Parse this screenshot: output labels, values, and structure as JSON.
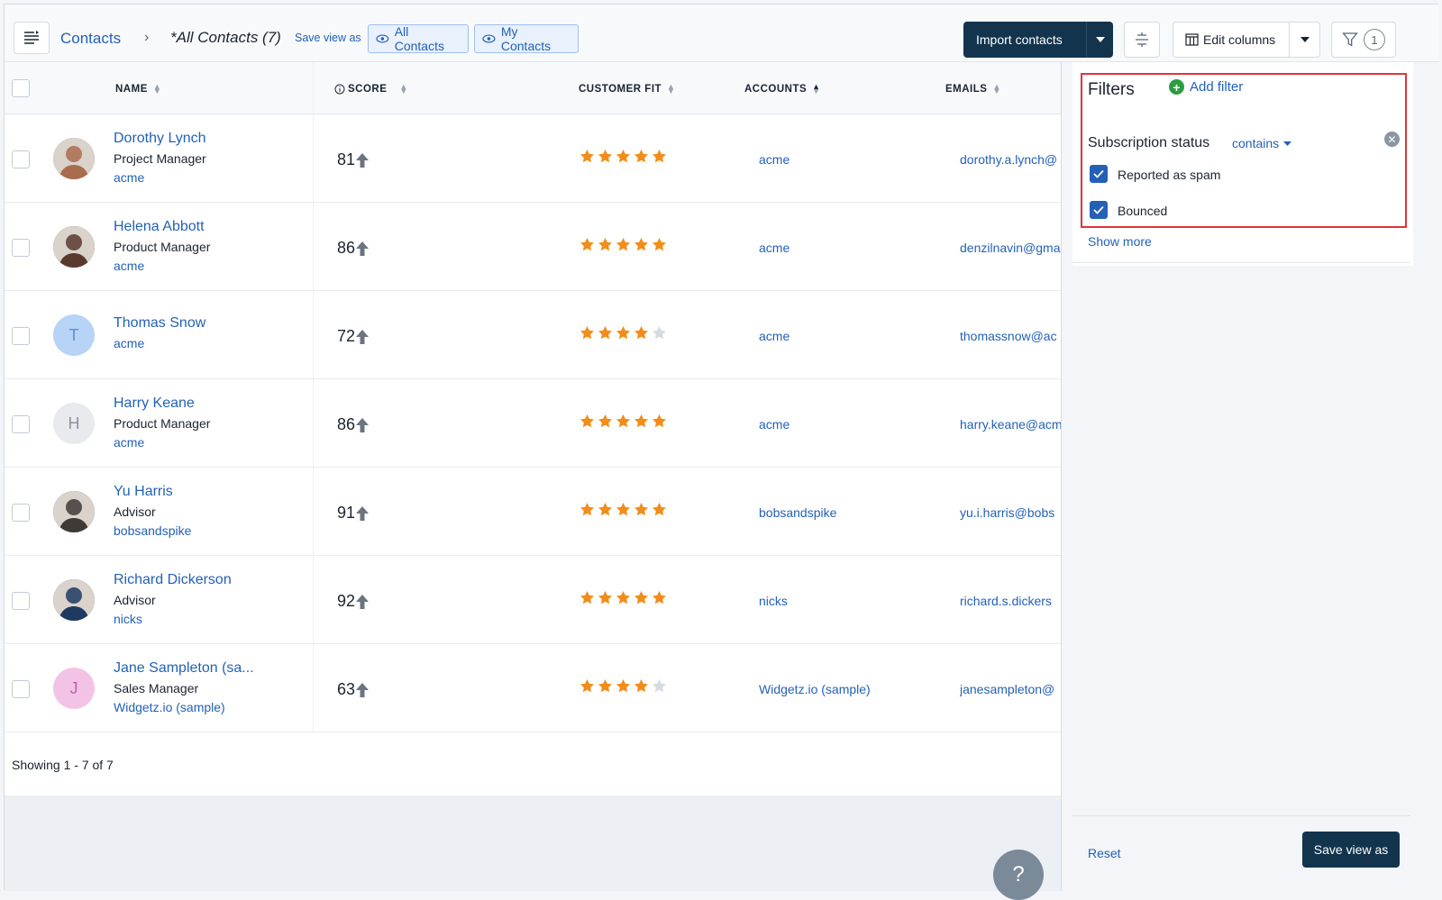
{
  "header": {
    "breadcrumb_root": "Contacts",
    "view_title": "*All Contacts (7)",
    "save_view_as": "Save view as",
    "view_pills": [
      "All Contacts",
      "My Contacts"
    ],
    "import_button": "Import contacts",
    "edit_columns": "Edit columns",
    "filter_count": "1"
  },
  "table": {
    "columns": [
      "NAME",
      "SCORE",
      "CUSTOMER FIT",
      "ACCOUNTS",
      "EMAILS"
    ],
    "rows": [
      {
        "name": "Dorothy Lynch",
        "title": "Project Manager",
        "account_small": "acme",
        "score": "81",
        "stars": 5,
        "account": "acme",
        "email": "dorothy.a.lynch@",
        "avatar": "photo",
        "avatar_color": "#a86d4e"
      },
      {
        "name": "Helena Abbott",
        "title": "Product Manager",
        "account_small": "acme",
        "score": "86",
        "stars": 5,
        "account": "acme",
        "email": "denzilnavin@gma",
        "avatar": "photo",
        "avatar_color": "#5b3a2e"
      },
      {
        "name": "Thomas Snow",
        "title": "",
        "account_small": "acme",
        "score": "72",
        "stars": 4,
        "account": "acme",
        "email": "thomassnow@ac",
        "avatar": "T",
        "avatar_color": "#b7d4f7"
      },
      {
        "name": "Harry Keane",
        "title": "Product Manager",
        "account_small": "acme",
        "score": "86",
        "stars": 5,
        "account": "acme",
        "email": "harry.keane@acm",
        "avatar": "H",
        "avatar_color": "#e8eaed"
      },
      {
        "name": "Yu Harris",
        "title": "Advisor",
        "account_small": "bobsandspike",
        "score": "91",
        "stars": 5,
        "account": "bobsandspike",
        "email": "yu.i.harris@bobs",
        "avatar": "photo",
        "avatar_color": "#3e3a36"
      },
      {
        "name": "Richard Dickerson",
        "title": "Advisor",
        "account_small": "nicks",
        "score": "92",
        "stars": 5,
        "account": "nicks",
        "email": "richard.s.dickers",
        "avatar": "photo",
        "avatar_color": "#1f3a60"
      },
      {
        "name": "Jane Sampleton (sa...",
        "title": "Sales Manager",
        "account_small": "Widgetz.io (sample)",
        "score": "63",
        "stars": 4,
        "account": "Widgetz.io (sample)",
        "email": "janesampleton@",
        "avatar": "J",
        "avatar_color": "#f3c3e6"
      }
    ],
    "showing": "Showing 1 - 7 of 7"
  },
  "filters": {
    "title": "Filters",
    "add_filter": "Add filter",
    "field_label": "Subscription status",
    "operator": "contains",
    "options": [
      "Reported as spam",
      "Bounced"
    ],
    "show_more": "Show more",
    "reset": "Reset",
    "save_view_as": "Save view as"
  },
  "help_icon": "?",
  "colors": {
    "accent": "#2461b6",
    "dark": "#12344d",
    "star": "#f28c1a",
    "highlight": "#e0343b"
  }
}
